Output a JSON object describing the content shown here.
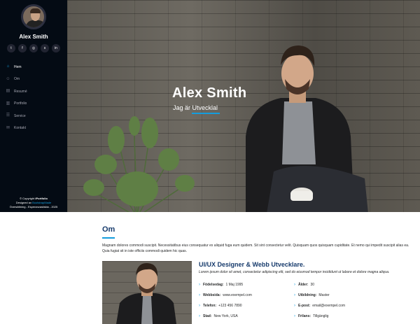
{
  "sidebar": {
    "name": "Alex Smith",
    "social": [
      {
        "icon": "twitter-icon",
        "glyph": "t"
      },
      {
        "icon": "facebook-icon",
        "glyph": "f"
      },
      {
        "icon": "instagram-icon",
        "glyph": "◎"
      },
      {
        "icon": "skype-icon",
        "glyph": "s"
      },
      {
        "icon": "linkedin-icon",
        "glyph": "in"
      }
    ],
    "nav": [
      {
        "label": "Hem",
        "icon": "home-icon",
        "glyph": "⌂"
      },
      {
        "label": "Om",
        "icon": "person-icon",
        "glyph": "☺"
      },
      {
        "label": "Resumé",
        "icon": "document-icon",
        "glyph": "▤"
      },
      {
        "label": "Portfolio",
        "icon": "book-icon",
        "glyph": "▥"
      },
      {
        "label": "Service",
        "icon": "server-icon",
        "glyph": "☰"
      },
      {
        "label": "Kontakt",
        "icon": "envelope-icon",
        "glyph": "✉"
      }
    ],
    "footer": {
      "copyright_prefix": "© Copyright ",
      "brand": "iPortfolio",
      "designed_prefix": "Designed av ",
      "designer": "BootstrapMade",
      "translation": "Översättning - Esperanzasfaktа - 2025"
    }
  },
  "hero": {
    "title": "Alex Smith",
    "subtitle": "Jag är Utvecklal"
  },
  "about": {
    "heading": "Om",
    "intro": "Magnam dolores commodi suscipit. Necessitatibus eius consequatur ex aliquid fuga eum quidem. Sit sint consectetur velit. Quisquam quos quisquam cupiditate. Et nemo qui impedit suscipit alias ea. Quia fugiat sit in iste officiis commodi quidem hic quas.",
    "role": "UI/UX Designer & Webb Utvecklare.",
    "role_desc": "Lorem ipsum dolor sit amet, consectetur adipiscing elit, sed do eiusmod tempor incididunt ut labore et dolore magna aliqua.",
    "facts_left": [
      {
        "label": "Födelsedag:",
        "value": "1 Maj 1995"
      },
      {
        "label": "Webbsida:",
        "value": "www.exempel.com"
      },
      {
        "label": "Telefon:",
        "value": "+123 456 7890"
      },
      {
        "label": "Stad:",
        "value": "New York, USA"
      }
    ],
    "facts_right": [
      {
        "label": "Ålder:",
        "value": "30"
      },
      {
        "label": "Utbildning:",
        "value": "Master"
      },
      {
        "label": "E-post:",
        "value": "email@exempel.com"
      },
      {
        "label": "Frilans:",
        "value": "Tillgänglig"
      }
    ]
  },
  "colors": {
    "accent": "#149ddd",
    "sidebar_bg": "#040b14",
    "heading": "#173b6c"
  }
}
